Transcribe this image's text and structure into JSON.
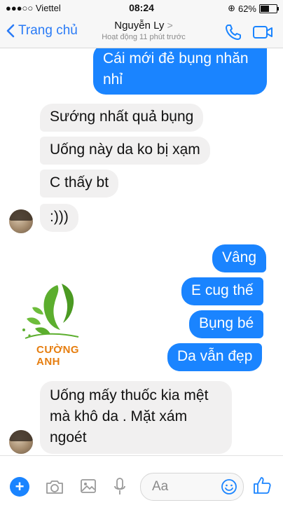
{
  "status_bar": {
    "carrier": "●●●○○ Viettel",
    "time": "08:24",
    "battery": "62%",
    "battery_level": 0.62
  },
  "header": {
    "back_label": "Trang chủ",
    "contact_name": "Nguyễn Ly",
    "chevron": ">",
    "activity": "Hoạt động 11 phút trước"
  },
  "messages": [
    {
      "side": "out",
      "text_line1": "Cái mới đẻ bụng nhăn",
      "text_line2": "nhỉ"
    },
    {
      "side": "in",
      "text": "Sướng nhất quả bụng"
    },
    {
      "side": "in",
      "text": "Uống này da ko bị xạm"
    },
    {
      "side": "in",
      "text": "C thấy bt"
    },
    {
      "side": "in",
      "text": ":)))"
    },
    {
      "side": "out",
      "text": "Vâng"
    },
    {
      "side": "out",
      "text": "E cug thế"
    },
    {
      "side": "out",
      "text": "Bụng bé"
    },
    {
      "side": "out",
      "text": "Da vẫn đẹp"
    },
    {
      "side": "in",
      "text_line1": "Uống mấy thuốc kia mệt",
      "text_line2": "mà khô da . Mặt xám",
      "text_line3": "ngoét"
    }
  ],
  "watermark": {
    "text": "CƯỜNG ANH"
  },
  "composer": {
    "placeholder": "Aa"
  },
  "colors": {
    "accent": "#1a84ff",
    "incoming_bubble": "#f1f0f0",
    "watermark_green": "#5cae2e",
    "watermark_orange": "#e67e10"
  }
}
